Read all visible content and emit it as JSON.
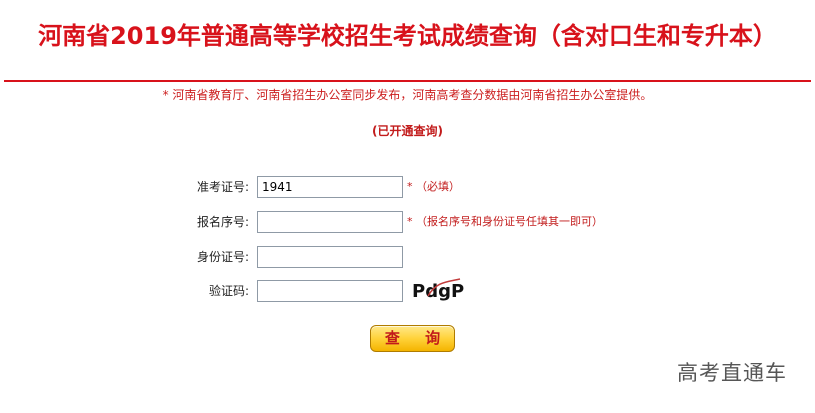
{
  "header": {
    "title": "河南省2019年普通高等学校招生考试成绩查询（含对口生和专升本）"
  },
  "notice": "* 河南省教育厅、河南省招生办公室同步发布，河南高考查分数据由河南省招生办公室提供。",
  "status": "(已开通查询)",
  "form": {
    "exam_number": {
      "label": "准考证号:",
      "value": "1941",
      "hint": "*  （必填）"
    },
    "registration_number": {
      "label": "报名序号:",
      "value": "",
      "hint": "*  （报名序号和身份证号任填其一即可）"
    },
    "id_number": {
      "label": "身份证号:",
      "value": ""
    },
    "captcha": {
      "label": "验证码:",
      "value": "",
      "image_text": "PdgP"
    }
  },
  "search_button": "查 询",
  "watermark": "高考直通车",
  "colors": {
    "accent": "#d8121b",
    "button": "#ffd23a"
  }
}
